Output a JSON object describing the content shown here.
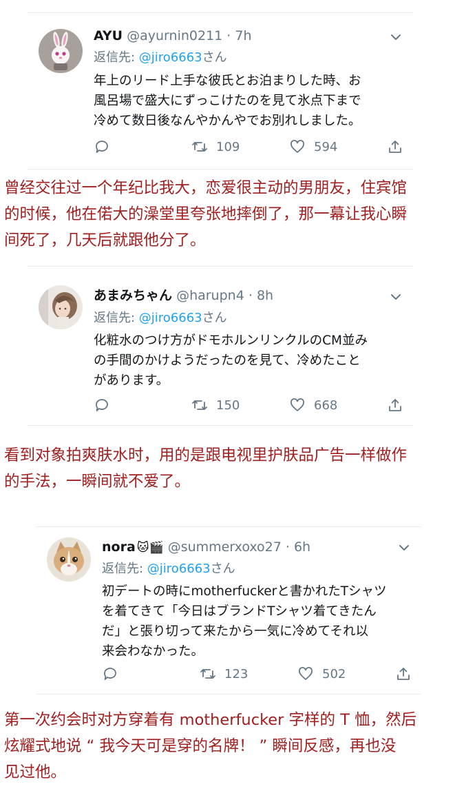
{
  "tweets": [
    {
      "display_name": "AYU",
      "handle": "@ayurnin0211",
      "separator": "·",
      "time": "7h",
      "reply_prefix": "返信先: ",
      "reply_mention": "@jiro6663",
      "reply_suffix": "さん",
      "lines": [
        "年上のリード上手な彼氏とお泊まりした時、お",
        "風呂場で盛大にずっこけたのを見て氷点下まで",
        "冷めて数日後なんやかんやでお別れしました。"
      ],
      "reply_count": "",
      "retweets": "109",
      "likes": "594",
      "avatar_icon": "bunny-avatar-icon"
    },
    {
      "display_name": "あまみちゃん",
      "handle": "@harupn4",
      "separator": "·",
      "time": "8h",
      "reply_prefix": "返信先: ",
      "reply_mention": "@jiro6663",
      "reply_suffix": "さん",
      "lines": [
        "化粧水のつけ方がドモホルンリンクルのCM並み",
        "の手間のかけようだったのを見て、冷めたこと",
        "があります。"
      ],
      "reply_count": "",
      "retweets": "150",
      "likes": "668",
      "avatar_icon": "girl-avatar-icon"
    },
    {
      "display_name": "nora",
      "name_emojis": "🐱🎬",
      "handle": "@summerxoxo27",
      "separator": "·",
      "time": "6h",
      "reply_prefix": "返信先: ",
      "reply_mention": "@jiro6663",
      "reply_suffix": "さん",
      "lines": [
        "初デートの時にmotherfuckerと書かれたTシャツ",
        "を着てきて「今日はブランドTシャツ着てきたん",
        "だ」と張り切って来たから一気に冷めてそれ以",
        "来会わなかった。"
      ],
      "reply_count": "",
      "retweets": "123",
      "likes": "502",
      "avatar_icon": "cat-avatar-icon"
    }
  ],
  "captions": [
    [
      "曾经交往过一个年纪比我大，恋爱很主动的男朋友，住宾馆",
      "的时候，他在偌大的澡堂里夸张地摔倒了，那一幕让我心瞬",
      "间死了，几天后就跟他分了。"
    ],
    [
      "看到对象拍爽肤水时，用的是跟电视里护肤品广告一样做作",
      "的手法，一瞬间就不爱了。"
    ],
    [
      "第一次约会时对方穿着有 motherfucker 字样的 T 恤，然后",
      "炫耀式地说 “ 我今天可是穿的名牌！ ” 瞬间反感，再也没",
      "见过他。"
    ]
  ],
  "colors": {
    "caption": "#a11f1f",
    "mention": "#1da1f2",
    "muted": "#657786",
    "text": "#14171a"
  }
}
